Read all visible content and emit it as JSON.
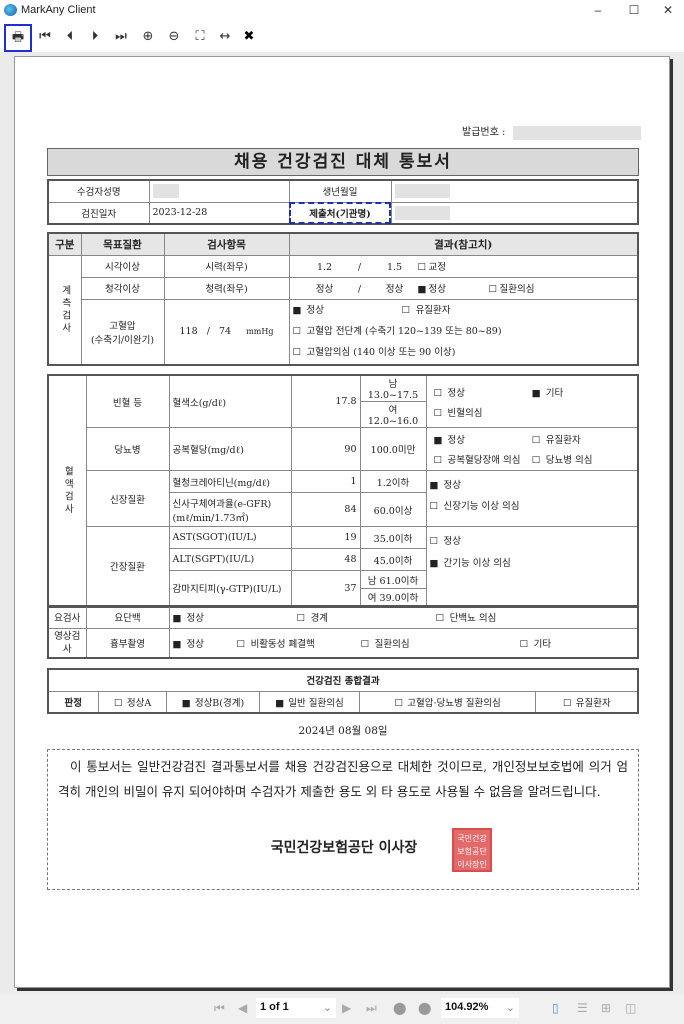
{
  "window": {
    "title": "MarkAny Client",
    "minimize": "–",
    "maximize": "☐",
    "close": "✕"
  },
  "toolbar": [
    {
      "name": "print",
      "glyph": "🖶"
    },
    {
      "name": "first-page",
      "glyph": "⏮"
    },
    {
      "name": "prev-page",
      "glyph": "⏴"
    },
    {
      "name": "next-page",
      "glyph": "⏵"
    },
    {
      "name": "last-page",
      "glyph": "⏭"
    },
    {
      "name": "zoom-in",
      "glyph": "⊕"
    },
    {
      "name": "zoom-out",
      "glyph": "⊖"
    },
    {
      "name": "fit-page",
      "glyph": "⛶"
    },
    {
      "name": "fit-width",
      "glyph": "↔"
    },
    {
      "name": "close-doc",
      "glyph": "✖"
    }
  ],
  "doc": {
    "issue_no_label": "발급번호 :",
    "title": "채용 건강검진 대체 통보서",
    "info": {
      "name_label": "수검자성명",
      "birth_label": "생년월일",
      "date_label": "검진일자",
      "date_value": "2023-12-28",
      "org_label": "제출처(기관명)"
    },
    "t1": {
      "headers": [
        "구분",
        "목표질환",
        "검사항목",
        "결과(참고치)"
      ],
      "category": "계측검사",
      "vision": {
        "disease": "시각이상",
        "item": "시력(좌우)",
        "left": "1.2",
        "sep": "/",
        "right": "1.5",
        "opt": {
          "label": "교정",
          "checked": false
        }
      },
      "hearing": {
        "disease": "청각이상",
        "item": "청력(좌우)",
        "left": "정상",
        "sep": "/",
        "right": "정상",
        "opts": [
          {
            "label": "정상",
            "checked": true
          },
          {
            "label": "질환의심",
            "checked": false
          }
        ]
      },
      "bp": {
        "disease": "고혈압",
        "disease2": "(수축기/이완기)",
        "sys": "118",
        "sep": "/",
        "dia": "74",
        "unit": "mmHg",
        "opts": [
          {
            "label": "정상",
            "checked": true
          },
          {
            "label": "유질환자",
            "checked": false
          },
          {
            "label": "고혈압 전단계 (수축기 120~139 또는 80~89)",
            "checked": false
          },
          {
            "label": "고혈압의심 (140 이상 또는 90 이상)",
            "checked": false
          }
        ]
      }
    },
    "t2": {
      "category": "혈액검사",
      "anemia": {
        "disease": "빈혈 등",
        "item": "혈색소(g/dℓ)",
        "value": "17.8",
        "ref_m": "남 13.0~17.5",
        "ref_f": "여 12.0~16.0",
        "opts": [
          {
            "label": "정상",
            "checked": false
          },
          {
            "label": "기타",
            "checked": true
          },
          {
            "label": "빈혈의심",
            "checked": false
          }
        ]
      },
      "diabetes": {
        "disease": "당뇨병",
        "item": "공복혈당(mg/dℓ)",
        "value": "90",
        "ref": "100.0미만",
        "opts": [
          {
            "label": "정상",
            "checked": true
          },
          {
            "label": "유질환자",
            "checked": false
          },
          {
            "label": "공복혈당장애 의심",
            "checked": false
          },
          {
            "label": "당뇨병 의심",
            "checked": false
          }
        ]
      },
      "kidney": {
        "disease": "신장질환",
        "items": [
          {
            "item": "혈청크레아티닌(mg/dℓ)",
            "value": "1",
            "ref": "1.2이하"
          },
          {
            "item": "신사구체여과율(e-GFR)",
            "item2": "(mℓ/min/1.73㎡)",
            "value": "84",
            "ref": "60.0이상"
          }
        ],
        "opts": [
          {
            "label": "정상",
            "checked": true
          },
          {
            "label": "신장기능 이상 의심",
            "checked": false
          }
        ]
      },
      "liver": {
        "disease": "간장질환",
        "items": [
          {
            "item": "AST(SGOT)(IU/L)",
            "value": "19",
            "ref": "35.0이하"
          },
          {
            "item": "ALT(SGPT)(IU/L)",
            "value": "48",
            "ref": "45.0이하"
          },
          {
            "item": "감마지티피(γ-GTP)(IU/L)",
            "value": "37",
            "ref_m": "남 61.0이하",
            "ref_f": "여 39.0이하"
          }
        ],
        "opts": [
          {
            "label": "정상",
            "checked": false
          },
          {
            "label": "간기능 이상 의심",
            "checked": true
          }
        ]
      }
    },
    "t3": {
      "urine": {
        "category": "요검사",
        "item": "요단백",
        "opts": [
          {
            "label": "정상",
            "checked": true
          },
          {
            "label": "경계",
            "checked": false
          },
          {
            "label": "단백뇨 의심",
            "checked": false
          }
        ]
      },
      "xray": {
        "category": "영상검사",
        "item": "흉부촬영",
        "opts": [
          {
            "label": "정상",
            "checked": true
          },
          {
            "label": "비활동성 폐결핵",
            "checked": false
          },
          {
            "label": "질환의심",
            "checked": false
          },
          {
            "label": "기타",
            "checked": false
          }
        ]
      }
    },
    "t4": {
      "title": "건강검진 종합결과",
      "label": "판정",
      "opts": [
        {
          "label": "정상A",
          "checked": false
        },
        {
          "label": "정상B(경계)",
          "checked": true
        },
        {
          "label": "일반 질환의심",
          "checked": true
        },
        {
          "label": "고혈압·당뇨병 질환의심",
          "checked": false
        },
        {
          "label": "유질환자",
          "checked": false
        }
      ]
    },
    "issue_date": "2024년 08월 08일",
    "notice": "이 통보서는 일반건강검진 결과통보서를 채용 건강검진용으로 대체한 것이므로, 개인정보보호법에 의거 엄격히 개인의 비밀이 유지 되어야하며 수검자가 제출한 용도 외 타 용도로 사용될 수 없음을 알려드립니다.",
    "signer": "국민건강보험공단 이사장",
    "seal_text": "국민건강보험공단이사장인",
    "seal_color": "#e05050"
  },
  "bottom": {
    "page": "1 of 1",
    "zoom": "104.92%"
  }
}
